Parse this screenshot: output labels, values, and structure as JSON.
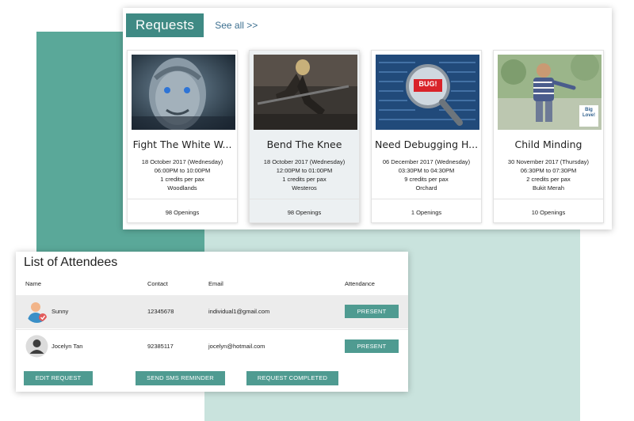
{
  "requests": {
    "title": "Requests",
    "see_all": "See all >>",
    "cards": [
      {
        "title": "Fight The White W...",
        "date": "18 October 2017 (Wednesday)",
        "time": "06:00PM to 10:00PM",
        "credits": "1 credits per pax",
        "location": "Woodlands",
        "openings": "98 Openings",
        "image": "night-king-image"
      },
      {
        "title": "Bend The Knee",
        "date": "18 October 2017 (Wednesday)",
        "time": "12:00PM to 01:00PM",
        "credits": "1 credits per pax",
        "location": "Westeros",
        "openings": "98 Openings",
        "image": "warrior-image"
      },
      {
        "title": "Need Debugging H...",
        "date": "06 December 2017 (Wednesday)",
        "time": "03:30PM to 04:30PM",
        "credits": "9 credits per pax",
        "location": "Orchard",
        "openings": "1 Openings",
        "image": "bug-magnifier-image",
        "bug_text": "BUG!"
      },
      {
        "title": "Child Minding",
        "date": "30 November 2017 (Thursday)",
        "time": "06:30PM to 07:30PM",
        "credits": "2 credits per pax",
        "location": "Bukit Merah",
        "openings": "10 Openings",
        "image": "child-image",
        "logo_text": "Big Love!"
      }
    ]
  },
  "attendees": {
    "title": "List of Attendees",
    "columns": {
      "name": "Name",
      "contact": "Contact",
      "email": "Email",
      "attendance": "Attendance"
    },
    "rows": [
      {
        "name": "Sunny",
        "contact": "12345678",
        "email": "individual1@gmail.com",
        "attendance": "PRESENT"
      },
      {
        "name": "Jocelyn Tan",
        "contact": "92385117",
        "email": "jocelyn@hotmail.com",
        "attendance": "PRESENT"
      }
    ],
    "actions": {
      "edit": "EDIT REQUEST",
      "sms": "SEND SMS REMINDER",
      "complete": "REQUEST COMPLETED"
    }
  },
  "colors": {
    "teal_dark": "#5aa899",
    "teal_light": "#c9e3dd",
    "button": "#4f9b91",
    "header": "#3f8a84"
  }
}
